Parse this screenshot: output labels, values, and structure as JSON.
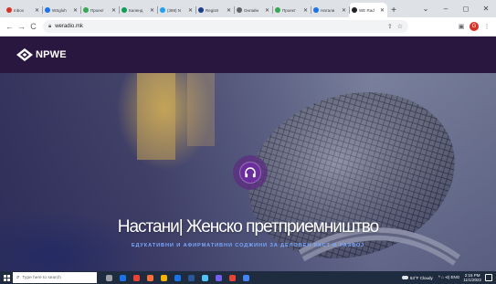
{
  "browser": {
    "tabs": [
      {
        "label": "Inbox",
        "color": "#d93025",
        "active": false
      },
      {
        "label": "WSgloh",
        "color": "#1a73e8",
        "active": false
      },
      {
        "label": "Проект",
        "color": "#34a853",
        "active": false
      },
      {
        "label": "Календ",
        "color": "#0f9d58",
        "active": false
      },
      {
        "label": "(389) N",
        "color": "#1da1f2",
        "active": false
      },
      {
        "label": "Registr",
        "color": "#1a3e8c",
        "active": false
      },
      {
        "label": "Онлайн",
        "color": "#5f6368",
        "active": false
      },
      {
        "label": "Проект",
        "color": "#34a853",
        "active": false
      },
      {
        "label": "Натали",
        "color": "#1a73e8",
        "active": false
      },
      {
        "label": "WE Rad",
        "color": "#202124",
        "active": true
      }
    ],
    "new_tab_label": "+",
    "window_controls": {
      "chevron": "⌄",
      "minimize": "–",
      "maximize": "◻",
      "close": "✕"
    },
    "toolbar": {
      "back": "←",
      "forward": "→",
      "reload": "C",
      "url": "weradio.mk",
      "lock_icon": "lock-icon",
      "share": "⇪",
      "bookmark": "☆",
      "profile_initial": "G"
    }
  },
  "site": {
    "logo_text": "NPWE",
    "hero": {
      "title": "Настани| Женско претприемништво",
      "subtitle": "ЕДУКАТИВНИ И АФИРМАТИВНИ СОДЖИНИ ЗА ДЕЛОВЕН РАСТ И РАЗВОЈ",
      "play_icon": "headphones-icon"
    },
    "colors": {
      "header_bg": "#2a1740",
      "play_button": "#6c2d9c",
      "subtitle": "#7aa8ff"
    }
  },
  "taskbar": {
    "search_placeholder": "Type here to search",
    "apps": [
      {
        "name": "task-view",
        "color": "#9aa0a6"
      },
      {
        "name": "edge",
        "color": "#1a73e8"
      },
      {
        "name": "chrome",
        "color": "#ea4335"
      },
      {
        "name": "firefox",
        "color": "#ff7139"
      },
      {
        "name": "explorer",
        "color": "#f4b400"
      },
      {
        "name": "mail",
        "color": "#1a73e8"
      },
      {
        "name": "word",
        "color": "#2b579a"
      },
      {
        "name": "files",
        "color": "#4fc3f7"
      },
      {
        "name": "viber",
        "color": "#7360f2"
      },
      {
        "name": "chrome-2",
        "color": "#ea4335"
      },
      {
        "name": "photos",
        "color": "#4285f4"
      }
    ],
    "weather": "63°F  Cloudy",
    "tray_text": "^  ⌂  ⊲)  ENG",
    "time": "2:15 PM",
    "date": "11/1/2022"
  }
}
